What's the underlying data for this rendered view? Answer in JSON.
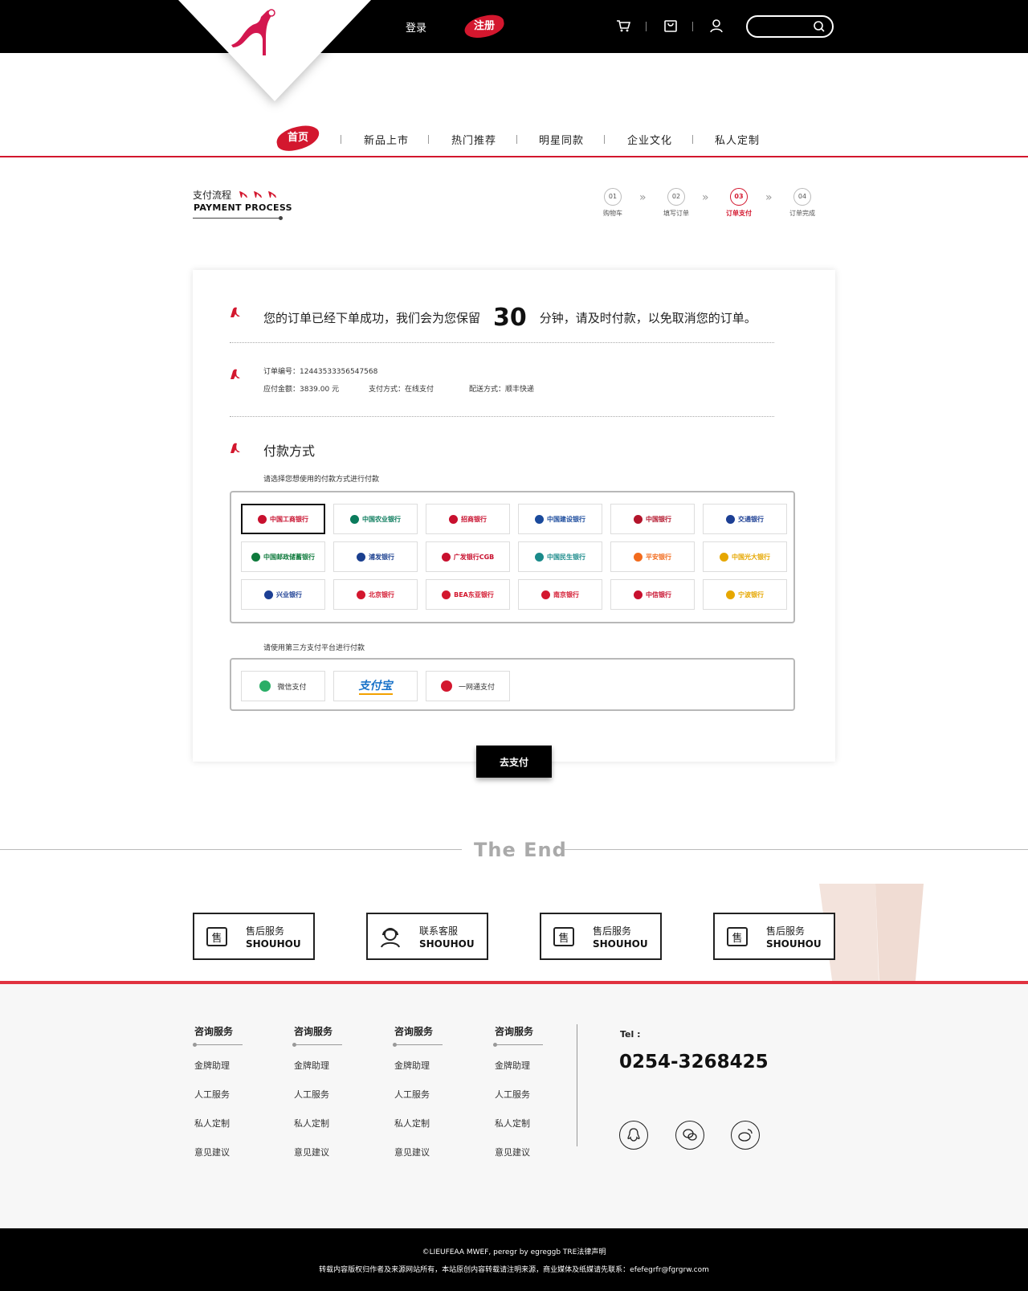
{
  "header": {
    "login": "登录",
    "register": "注册",
    "search_placeholder": ""
  },
  "nav": {
    "items": [
      "首页",
      "新品上市",
      "热门推荐",
      "明星同款",
      "企业文化",
      "私人定制"
    ],
    "active": "首页"
  },
  "process": {
    "title": "支付流程",
    "title_en": "PAYMENT PROCESS",
    "steps": [
      {
        "num": "01",
        "label": "购物车"
      },
      {
        "num": "02",
        "label": "填写订单"
      },
      {
        "num": "03",
        "label": "订单支付"
      },
      {
        "num": "04",
        "label": "订单完成"
      }
    ],
    "active_step": "03"
  },
  "order": {
    "msg_before": "您的订单已经下单成功，我们会为您保留",
    "minutes": "30",
    "msg_after": "分钟，请及时付款，以免取消您的订单。",
    "order_no": "订单编号：12443533356547568",
    "amount": "应付金额：3839.00 元",
    "pay_method": "支付方式：在线支付",
    "delivery": "配送方式：顺丰快递"
  },
  "payment": {
    "title": "付款方式",
    "bank_hint": "请选择您想使用的付款方式进行付款",
    "banks": [
      {
        "name": "中国工商银行",
        "color": "#c8102e",
        "selected": true
      },
      {
        "name": "中国农业银行",
        "color": "#0a7b5c",
        "selected": false
      },
      {
        "name": "招商银行",
        "color": "#c8102e",
        "selected": false
      },
      {
        "name": "中国建设银行",
        "color": "#1a4a9c",
        "selected": false
      },
      {
        "name": "中国银行",
        "color": "#b3142b",
        "selected": false
      },
      {
        "name": "交通银行",
        "color": "#1c3f94",
        "selected": false
      },
      {
        "name": "中国邮政储蓄银行",
        "color": "#0e7a3c",
        "selected": false
      },
      {
        "name": "浦发银行",
        "color": "#1a3f8f",
        "selected": false
      },
      {
        "name": "广发银行CGB",
        "color": "#c8102e",
        "selected": false
      },
      {
        "name": "中国民生银行",
        "color": "#1a8a8a",
        "selected": false
      },
      {
        "name": "平安银行",
        "color": "#f26b1d",
        "selected": false
      },
      {
        "name": "中国光大银行",
        "color": "#e6a700",
        "selected": false
      },
      {
        "name": "兴业银行",
        "color": "#1c3f94",
        "selected": false
      },
      {
        "name": "北京银行",
        "color": "#d3172e",
        "selected": false
      },
      {
        "name": "BEA东亚银行",
        "color": "#d3172e",
        "selected": false
      },
      {
        "name": "南京银行",
        "color": "#d3172e",
        "selected": false
      },
      {
        "name": "中信银行",
        "color": "#c8102e",
        "selected": false
      },
      {
        "name": "宁波银行",
        "color": "#e6a700",
        "selected": false
      }
    ],
    "third_hint": "请使用第三方支付平台进行付款",
    "third": [
      {
        "name": "微信支付",
        "color": "#2aae67"
      },
      {
        "name": "支付宝",
        "color": "#1a73c8"
      },
      {
        "name": "一网通支付",
        "color": "#d3172e"
      }
    ],
    "go_pay": "去支付"
  },
  "end_text": "The End",
  "services": [
    {
      "title": "售后服务",
      "sub": "SHOUHOU",
      "icon": "after-sale-icon"
    },
    {
      "title": "联系客服",
      "sub": "SHOUHOU",
      "icon": "customer-service-icon"
    },
    {
      "title": "售后服务",
      "sub": "SHOUHOU",
      "icon": "after-sale-icon"
    },
    {
      "title": "售后服务",
      "sub": "SHOUHOU",
      "icon": "after-sale-icon"
    }
  ],
  "footer": {
    "columns": [
      {
        "title": "咨询服务",
        "links": [
          "金牌助理",
          "人工服务",
          "私人定制",
          "意见建议"
        ]
      },
      {
        "title": "咨询服务",
        "links": [
          "金牌助理",
          "人工服务",
          "私人定制",
          "意见建议"
        ]
      },
      {
        "title": "咨询服务",
        "links": [
          "金牌助理",
          "人工服务",
          "私人定制",
          "意见建议"
        ]
      },
      {
        "title": "咨询服务",
        "links": [
          "金牌助理",
          "人工服务",
          "私人定制",
          "意见建议"
        ]
      }
    ],
    "tel_label": "Tel :",
    "tel": "0254-3268425",
    "social": [
      "qq-icon",
      "wechat-icon",
      "weibo-icon"
    ]
  },
  "copyright": {
    "line1": "©LIEUFEAA MWEF, peregr by egreggb TRE法律声明",
    "line2": "转载内容版权归作者及来源网站所有，本站原创内容转载请注明来源，商业媒体及纸媒请先联系：efefegrfr@fgrgrw.com"
  },
  "colors": {
    "accent": "#d3172e",
    "footer_bg": "#f7f7f7",
    "topbar": "#000000"
  }
}
